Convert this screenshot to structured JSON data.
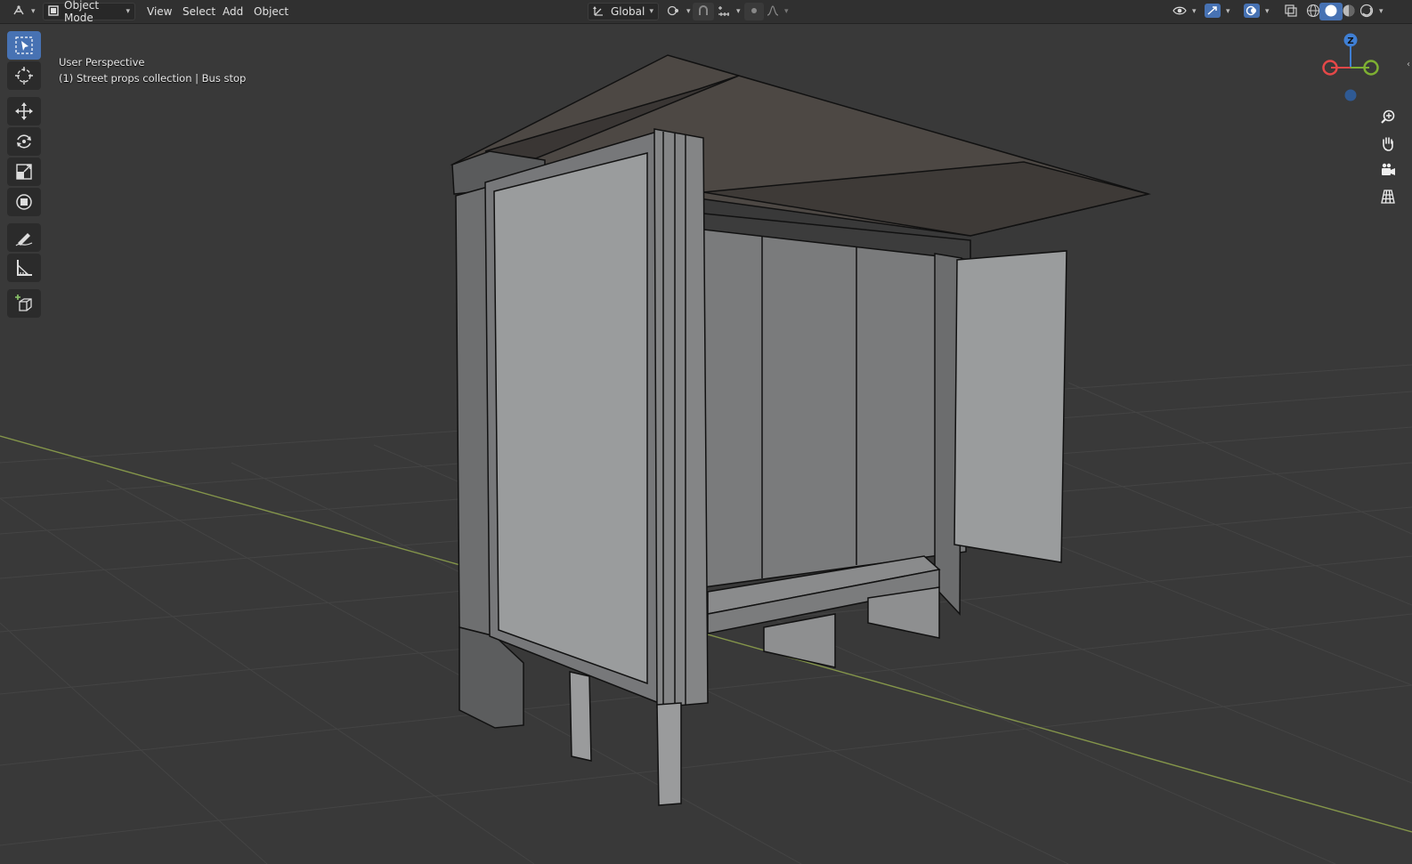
{
  "header": {
    "editor_type_icon": "3d-viewport-icon",
    "mode": "Object Mode",
    "menu": [
      "View",
      "Select",
      "Add",
      "Object"
    ],
    "transform_orientation": "Global",
    "icons_center": [
      "transform-orientation-icon",
      "pivot-point-icon",
      "snap-icon",
      "snap-increment-icon",
      "proportional-editing-icon",
      "falloff-curve-icon"
    ],
    "icons_right": [
      "visibility-eye-icon",
      "gizmo-icon",
      "overlay-icon",
      "xray-icon",
      "wireframe-shading-icon",
      "solid-shading-icon",
      "material-preview-icon",
      "rendered-shading-icon"
    ]
  },
  "viewport": {
    "view_name": "User Perspective",
    "object_info": "(1) Street props collection | Bus stop"
  },
  "toolbar": {
    "tools": [
      "select-box-tool",
      "cursor-tool",
      "move-tool",
      "rotate-tool",
      "scale-tool",
      "transform-tool",
      "annotate-tool",
      "measure-tool",
      "add-cube-tool"
    ],
    "active": "select-box-tool"
  },
  "navigation": {
    "gizmo_axis_label": "Z",
    "axis_colors": {
      "x": "#e54848",
      "y": "#7eb032",
      "z": "#3f7fd4"
    },
    "buttons": [
      "zoom-icon",
      "pan-hand-icon",
      "camera-icon",
      "ortho-grid-icon"
    ]
  },
  "colors": {
    "header_bg": "#303030",
    "viewport_bg": "#393939",
    "active_blue": "#4772b3",
    "grid_line": "#4a4a4a",
    "x_axis_line": "#8a9a44",
    "panel_light": "#9a9c9d"
  }
}
